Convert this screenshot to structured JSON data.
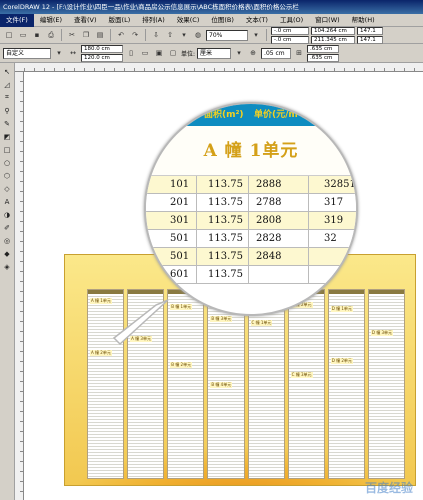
{
  "window": {
    "title": "CorelDRAW 12 - [F:\\设计作业\\四臣一品\\作业\\商品房公示信息展示\\ABC栋面积价格表\\面积价格公示栏"
  },
  "menu": {
    "items": [
      "文件(F)",
      "编辑(E)",
      "查看(V)",
      "版面(L)",
      "排列(A)",
      "效果(C)",
      "位图(B)",
      "文本(T)",
      "工具(O)",
      "窗口(W)",
      "帮助(H)"
    ]
  },
  "toolbar": {
    "zoom": "70%",
    "pos_x": "-.0 cm",
    "pos_y": "-.0 cm",
    "coord1": "104.264 cm",
    "coord2": "211.345 cm",
    "scale1": "147.1",
    "scale2": "147.1"
  },
  "propbar": {
    "preset": "自定义",
    "width": "180.0 cm",
    "height": "120.0 cm",
    "unit_label": "单位:",
    "unit": "厘米",
    "nudge": ".05 cm",
    "dup_x": ".635 cm",
    "dup_y": ".635 cm"
  },
  "board": {
    "title": "面积价格公示栏",
    "column_tags": [
      [
        "A 幢 1单元",
        "A 幢 2单元"
      ],
      [
        "A 幢 3单元"
      ],
      [
        "B 幢 1单元",
        "B 幢 2单元"
      ],
      [
        "B 幢 3单元",
        "B 幢 4单元"
      ],
      [
        "C 幢 1单元"
      ],
      [
        "C 幢 2单元",
        "C 幢 3单元"
      ],
      [
        "D 幢 1单元",
        "D 幢 2单元"
      ],
      [
        "D 幢 3单元"
      ]
    ]
  },
  "magnifier": {
    "headers": [
      "号",
      "面积(m²)",
      "单价(元/m²)",
      "总"
    ],
    "banner": "A 幢  1单元",
    "rows": [
      [
        "101",
        "113.75",
        "2888",
        "32851"
      ],
      [
        "201",
        "113.75",
        "2788",
        "317"
      ],
      [
        "301",
        "113.75",
        "2808",
        "319"
      ],
      [
        "501",
        "113.75",
        "2828",
        "32"
      ],
      [
        "501",
        "113.75",
        "2848",
        ""
      ],
      [
        "601",
        "113.75",
        "",
        ""
      ]
    ]
  },
  "watermark": "百度经验"
}
